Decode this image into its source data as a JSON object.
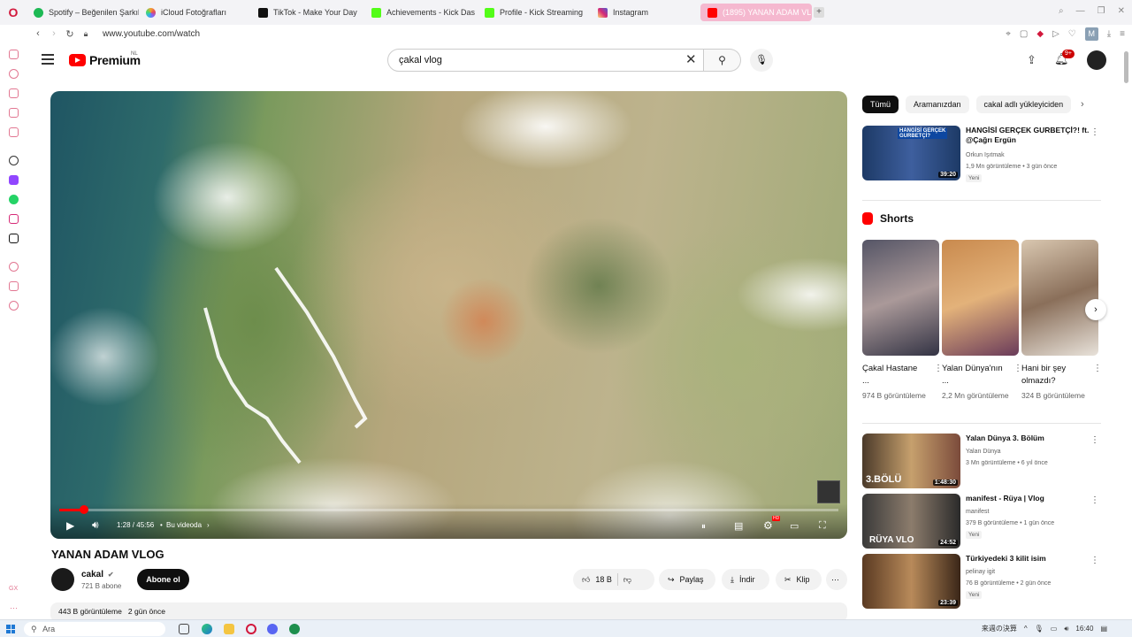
{
  "browser": {
    "tabs": [
      {
        "label": "Spotify – Beğenilen Şarkıl",
        "color": "#1db954"
      },
      {
        "label": "iCloud Fotoğrafları",
        "color": "#f4a22d"
      },
      {
        "label": "TikTok - Make Your Day",
        "color": "#111111"
      },
      {
        "label": "Achievements - Kick Das",
        "color": "#53fc18"
      },
      {
        "label": "Profile - Kick Streaming",
        "color": "#53fc18"
      },
      {
        "label": "Instagram",
        "color": "#d62976"
      },
      {
        "label": "(1895) YANAN ADAM VL",
        "color": "#ff0000"
      }
    ],
    "url": "www.youtube.com/watch",
    "profile_letter": "M"
  },
  "yt": {
    "brand": "Premium",
    "region": "NL",
    "search_value": "çakal vlog",
    "notification_count": "9+"
  },
  "player": {
    "time": "1:28 / 45:56",
    "chapter": "Bu videoda",
    "progress": 0.032
  },
  "video": {
    "title": "YANAN ADAM VLOG",
    "channel": "cakal",
    "subscribers": "721 B abone",
    "subscribe_label": "Abone ol",
    "likes": "18 B",
    "share_label": "Paylaş",
    "download_label": "İndir",
    "clip_label": "Klip",
    "views": "443 B görüntüleme",
    "age": "2 gün önce"
  },
  "chips": [
    "Tümü",
    "Aramanızdan",
    "cakal adlı yükleyiciden"
  ],
  "recs_top": {
    "title": "HANGİSİ GERÇEK GURBETÇİ?! ft. @Çağrı Ergün",
    "channel": "Orkun Işıtmak",
    "meta": "1,9 Mn görüntüleme • 3 gün önce",
    "badge": "Yeni",
    "duration": "39:20"
  },
  "shorts": {
    "heading": "Shorts",
    "items": [
      {
        "title": "Çakal Hastane ...",
        "views": "974 B görüntüleme"
      },
      {
        "title": "Yalan Dünya'nın ...",
        "views": "2,2 Mn görüntüleme"
      },
      {
        "title": "Hani bir şey olmazdı?",
        "views": "324 B görüntüleme"
      }
    ]
  },
  "recs": [
    {
      "title": "Yalan Dünya 3. Bölüm",
      "channel": "Yalan Dünya",
      "meta": "3 Mn görüntüleme • 6 yıl önce",
      "badge": "",
      "duration": "1:48:30"
    },
    {
      "title": "manifest - Rüya | Vlog",
      "channel": "manifest",
      "meta": "379 B görüntüleme • 1 gün önce",
      "badge": "Yeni",
      "duration": "24:52"
    },
    {
      "title": "Türkiyedeki 3 kilit isim",
      "channel": "pelinay igit",
      "meta": "76 B görüntüleme • 2 gün önce",
      "badge": "Yeni",
      "duration": "23:39"
    }
  ],
  "taskbar": {
    "search_placeholder": "Ara",
    "tray_text": "来週の決算",
    "clock": "16:40"
  }
}
